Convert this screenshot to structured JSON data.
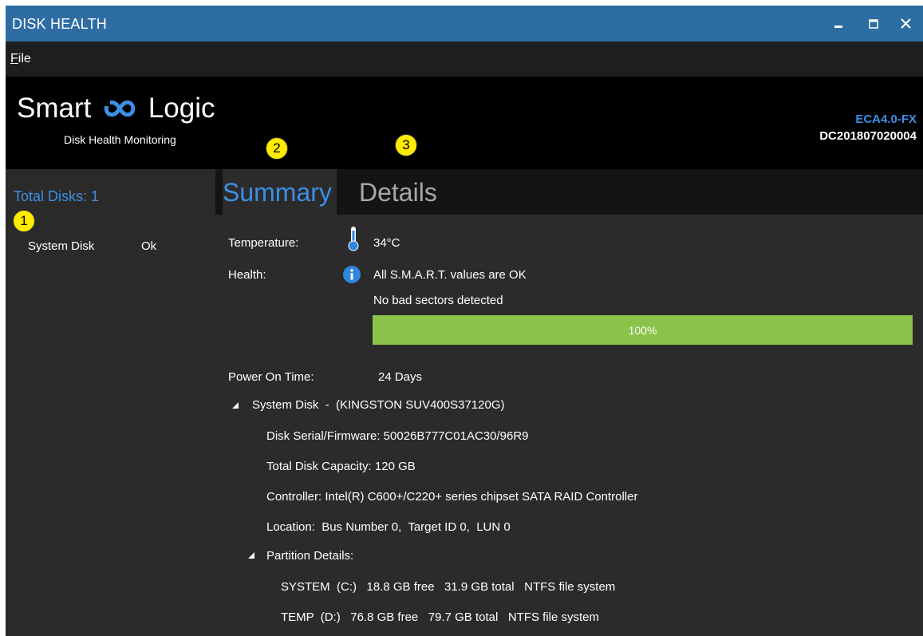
{
  "window": {
    "title": "DISK HEALTH",
    "min_glyph": "▬",
    "max_glyph": "□",
    "close_glyph": "✕"
  },
  "menu": {
    "file_accel": "F",
    "file_rest": "ile"
  },
  "header": {
    "brand_left": "Smart",
    "brand_right": "Logic",
    "tagline": "Disk Health Monitoring",
    "model": "ECA4.0-FX",
    "serial": "DC201807020004"
  },
  "markers": [
    "1",
    "2",
    "3"
  ],
  "sidebar": {
    "total_disks": "Total Disks: 1",
    "disks": [
      {
        "name": "System Disk",
        "status": "Ok"
      }
    ]
  },
  "tabs": {
    "summary": "Summary",
    "details": "Details"
  },
  "summary": {
    "temperature_label": "Temperature:",
    "temperature_value": "34°C",
    "health_label": "Health:",
    "health_line1": "All S.M.A.R.T. values are OK",
    "health_line2": "No bad sectors detected",
    "health_percent_text": "100%",
    "health_percent": 100,
    "power_on_label": "Power On Time:",
    "power_on_value": "24 Days",
    "disk_node": "System Disk  -  (KINGSTON SUV400S37120G)",
    "serial_firmware": "Disk Serial/Firmware: 50026B777C01AC30/96R9",
    "capacity": "Total Disk Capacity: 120 GB",
    "controller": "Controller: Intel(R) C600+/C220+ series chipset SATA RAID Controller",
    "location": "Location:  Bus Number 0,  Target ID 0,  LUN 0",
    "partition_node": "Partition Details:",
    "partitions": [
      "SYSTEM  (C:)   18.8 GB free   31.9 GB total   NTFS file system",
      "TEMP  (D:)   76.8 GB free   79.7 GB total   NTFS file system"
    ]
  },
  "colors": {
    "titlebar": "#2e6da4",
    "accent": "#3d8fe6",
    "progress": "#8bc34a",
    "marker": "#ffea00"
  },
  "icons": {
    "thermometer": "thermometer-icon",
    "info": "info-icon",
    "expand": "triangle-expanded-icon",
    "logo": "infinity-logo-icon"
  }
}
